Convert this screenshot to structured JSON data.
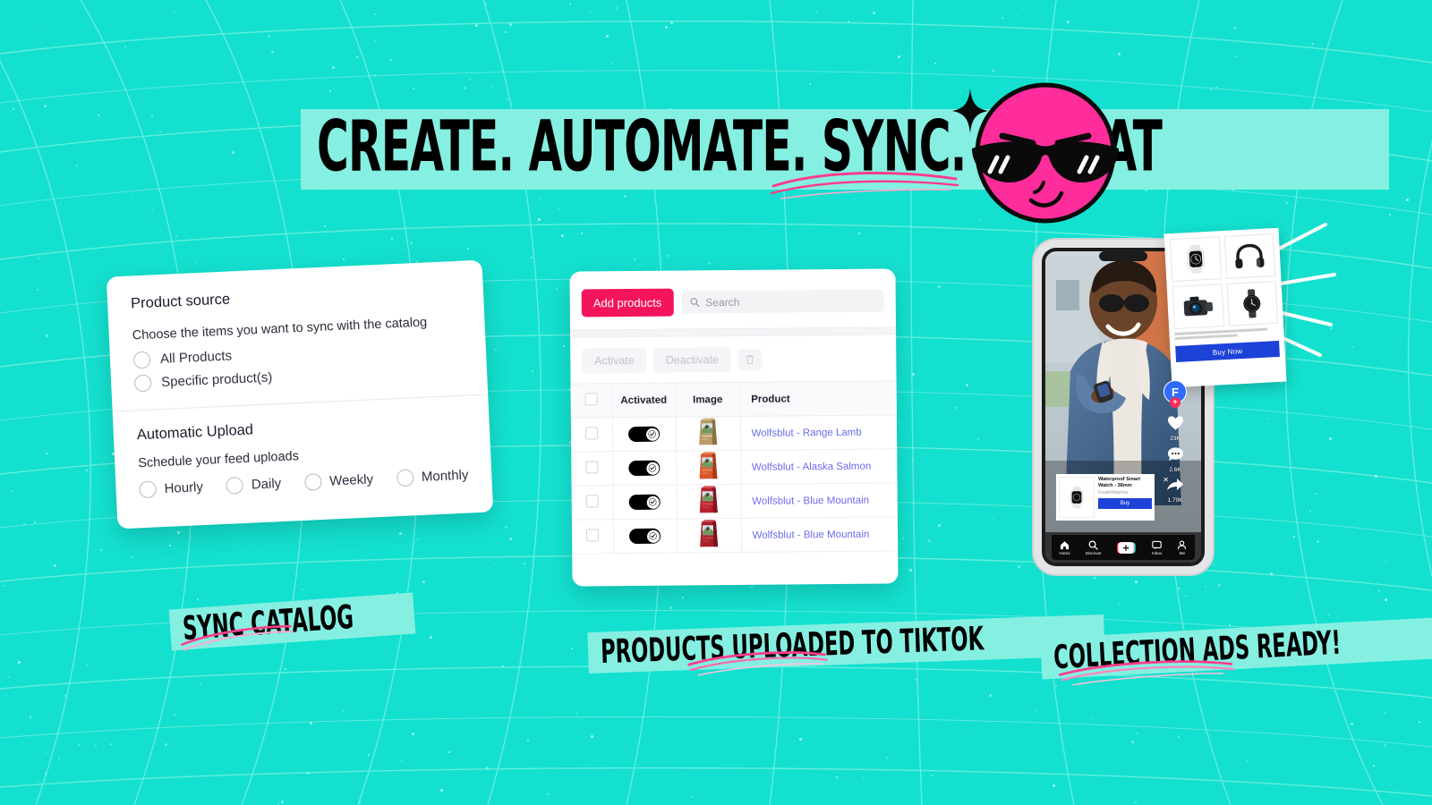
{
  "theme": {
    "background": "#14e0cf",
    "band": "#85f0e2",
    "accent_pink": "#f4145b",
    "underline_pink": "#ff3d8b",
    "link_blue": "#6d6ded",
    "buy_blue": "#1d42d8",
    "face_pink": "#ff2d9b"
  },
  "headline": {
    "text": "CREATE. AUTOMATE. SYNC. REPEAT"
  },
  "mascot": {
    "sparkle_icon": "sparkle-icon",
    "face_icon": "cool-face-icon"
  },
  "product_source_card": {
    "title": "Product source",
    "subtitle": "Choose the items you want to sync with the catalog",
    "options": [
      {
        "label": "All Products",
        "selected": false
      },
      {
        "label": "Specific product(s)",
        "selected": false
      }
    ],
    "automatic_upload": {
      "title": "Automatic Upload",
      "subtitle": "Schedule your feed uploads",
      "options": [
        {
          "label": "Hourly",
          "selected": false
        },
        {
          "label": "Daily",
          "selected": false
        },
        {
          "label": "Weekly",
          "selected": false
        },
        {
          "label": "Monthly",
          "selected": false
        }
      ]
    }
  },
  "products_card": {
    "add_products_label": "Add products",
    "search_placeholder": "Search",
    "search_value": "",
    "search_icon": "search-icon",
    "actions": [
      {
        "label": "Activate",
        "disabled": true
      },
      {
        "label": "Deactivate",
        "disabled": true
      }
    ],
    "delete_icon": "trash-icon",
    "columns": [
      "",
      "Activated",
      "Image",
      "Product"
    ],
    "rows": [
      {
        "checked": false,
        "activated": true,
        "image": "dog-food-bag-tan",
        "product": "Wolfsblut - Range Lamb"
      },
      {
        "checked": false,
        "activated": true,
        "image": "dog-food-bag-orange",
        "product": "Wolfsblut - Alaska Salmon"
      },
      {
        "checked": false,
        "activated": true,
        "image": "dog-food-bag-red",
        "product": "Wolfsblut - Blue Mountain"
      },
      {
        "checked": false,
        "activated": true,
        "image": "dog-food-bag-darkred",
        "product": "Wolfsblut - Blue Mountain"
      }
    ]
  },
  "phone": {
    "product_overlay": {
      "title": "Waterproof Smart Watch - 38mm",
      "seller": "FoodoWatches",
      "buy_label": "Buy",
      "close_icon": "close-icon",
      "thumb_icon": "smartwatch-icon"
    },
    "rail": {
      "avatar_letter": "F",
      "follow_badge": "+",
      "like_icon": "heart-icon",
      "like_count": "23K",
      "comment_icon": "comment-icon",
      "comment_count": "2.6K",
      "share_icon": "share-icon",
      "share_count": "1.79K"
    },
    "nav": [
      {
        "icon": "home-icon",
        "label": "Home"
      },
      {
        "icon": "search-icon",
        "label": "Discover"
      },
      {
        "icon": "plus-icon",
        "label": ""
      },
      {
        "icon": "inbox-icon",
        "label": "Inbox"
      },
      {
        "icon": "person-icon",
        "label": "Me"
      }
    ]
  },
  "collection_ad": {
    "tiles": [
      {
        "icon": "smartwatch-icon"
      },
      {
        "icon": "headphones-icon"
      },
      {
        "icon": "camera-icon"
      },
      {
        "icon": "analog-watch-icon"
      }
    ],
    "buy_now_label": "Buy Now"
  },
  "stickers": {
    "sync_catalog": "SYNC CATALOG",
    "products_uploaded": "PRODUCTS UPLOADED TO TIKTOK",
    "collection_ads": "COLLECTION ADS READY!"
  }
}
